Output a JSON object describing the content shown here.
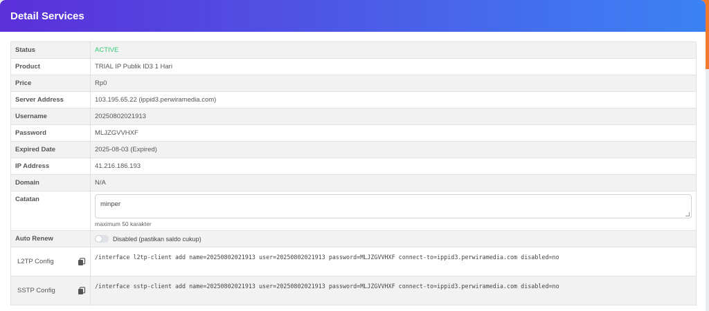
{
  "header": {
    "title": "Detail Services"
  },
  "rows": {
    "status": {
      "label": "Status",
      "value": "ACTIVE"
    },
    "product": {
      "label": "Product",
      "value": "TRIAL IP Publik ID3 1 Hari"
    },
    "price": {
      "label": "Price",
      "value": "Rp0"
    },
    "server": {
      "label": "Server Address",
      "value": "103.195.65.22 (ippid3.perwiramedia.com)"
    },
    "username": {
      "label": "Username",
      "value": "20250802021913"
    },
    "password": {
      "label": "Password",
      "value": "MLJZGVVHXF"
    },
    "expired": {
      "label": "Expired Date",
      "value": "2025-08-03 (Expired)"
    },
    "ip": {
      "label": "IP Address",
      "value": "41.216.186.193"
    },
    "domain": {
      "label": "Domain",
      "value": "N/A"
    },
    "notes": {
      "label": "Catatan",
      "value": "minper",
      "hint": "maximum 50 karakter"
    },
    "autorenew": {
      "label": "Auto Renew",
      "toggle_text": "Disabled (pastikan saldo cukup)",
      "enabled": false
    },
    "l2tp": {
      "label": "L2TP Config",
      "value": "/interface l2tp-client add name=20250802021913 user=20250802021913 password=MLJZGVVHXF connect-to=ippid3.perwiramedia.com disabled=no"
    },
    "sstp": {
      "label": "SSTP Config",
      "value": "/interface sstp-client add name=20250802021913 user=20250802021913 password=MLJZGVVHXF connect-to=ippid3.perwiramedia.com disabled=no"
    }
  },
  "colors": {
    "header_start": "#5b2fd9",
    "header_end": "#3b82f6",
    "active": "#2ecc71"
  },
  "icons": {
    "copy": "copy-icon"
  }
}
